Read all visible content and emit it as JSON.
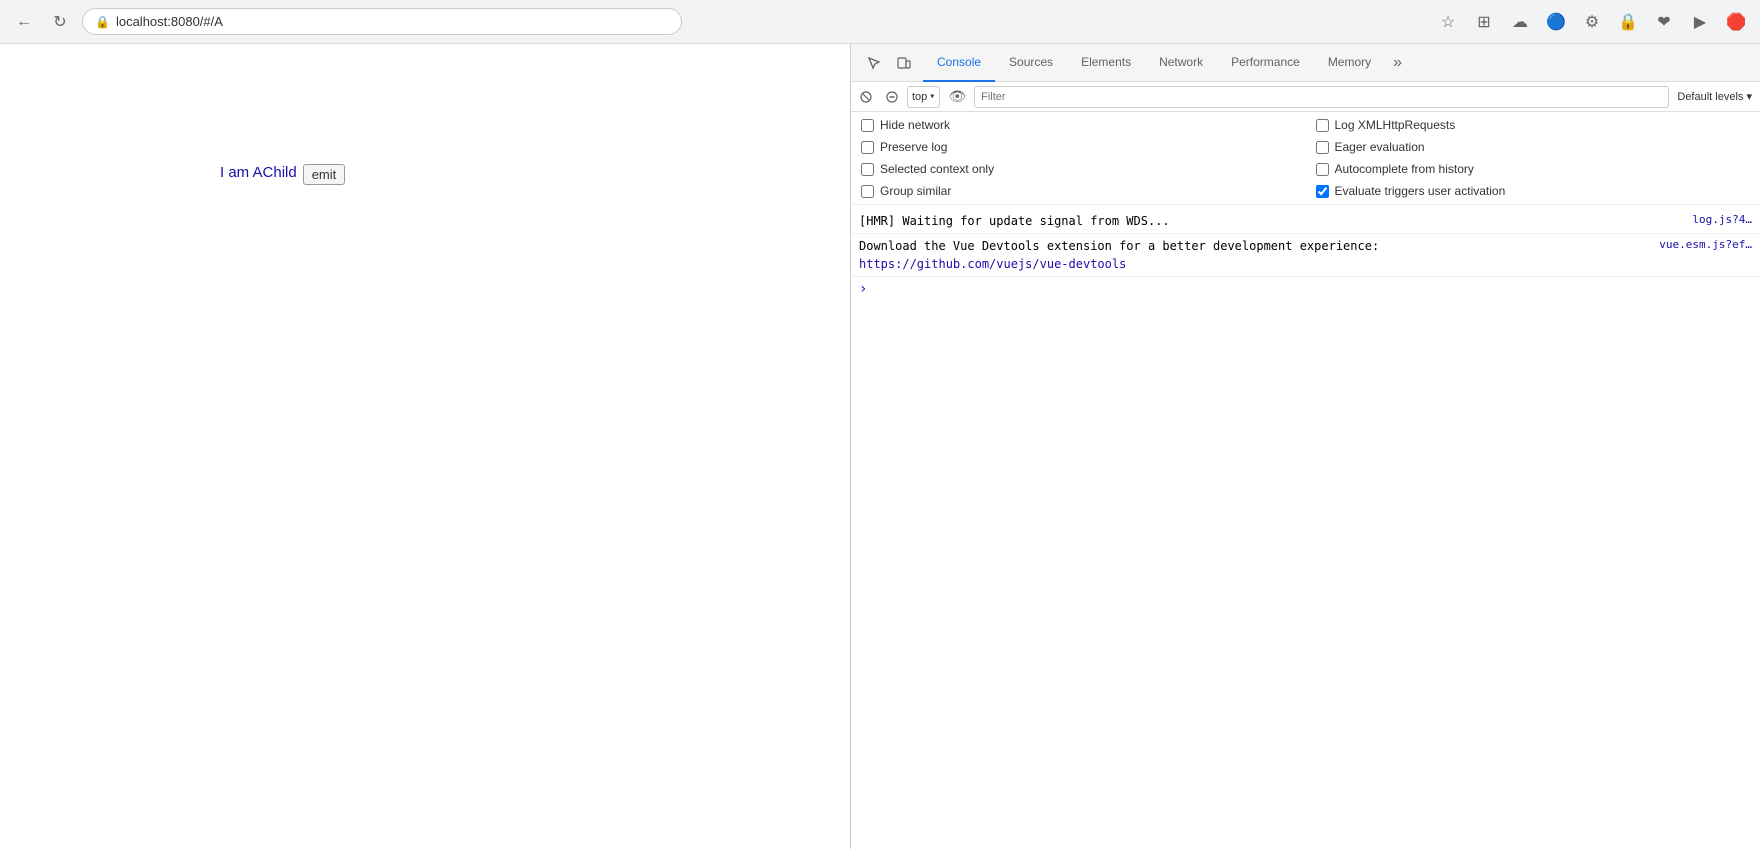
{
  "browser": {
    "address": "localhost:8080/#/A",
    "back_label": "←",
    "reload_label": "↻",
    "bookmark_label": "☆",
    "toolbar_icons": [
      "⊕",
      "☁",
      "⚙",
      "🔒",
      "❤",
      "▶",
      "🛡"
    ]
  },
  "page": {
    "content_text": "I am AChild",
    "emit_button_label": "emit"
  },
  "devtools": {
    "tabs": [
      {
        "label": "Console",
        "active": true
      },
      {
        "label": "Sources",
        "active": false
      },
      {
        "label": "Elements",
        "active": false
      },
      {
        "label": "Network",
        "active": false
      },
      {
        "label": "Performance",
        "active": false
      },
      {
        "label": "Memory",
        "active": false
      }
    ],
    "toolbar2": {
      "context_select": "top",
      "filter_placeholder": "Filter",
      "levels_label": "Default levels ▾"
    },
    "checkboxes": [
      {
        "label": "Hide network",
        "checked": false
      },
      {
        "label": "Log XMLHttpRequests",
        "checked": false
      },
      {
        "label": "Preserve log",
        "checked": false
      },
      {
        "label": "Eager evaluation",
        "checked": false
      },
      {
        "label": "Selected context only",
        "checked": false
      },
      {
        "label": "Autocomplete from history",
        "checked": false
      },
      {
        "label": "Group similar",
        "checked": false
      },
      {
        "label": "Evaluate triggers user activation",
        "checked": true
      }
    ],
    "console_messages": [
      {
        "text": "[HMR] Waiting for update signal from WDS...",
        "source": "log.js?4…"
      },
      {
        "text": "Download the Vue Devtools extension for a better development experience:\nhttps://github.com/vuejs/vue-devtools",
        "source": "vue.esm.js?ef…",
        "has_link": true,
        "link_text": "https://github.com/vuejs/vue-devtools",
        "link_href": "https://github.com/vuejs/vue-devtools"
      }
    ]
  }
}
